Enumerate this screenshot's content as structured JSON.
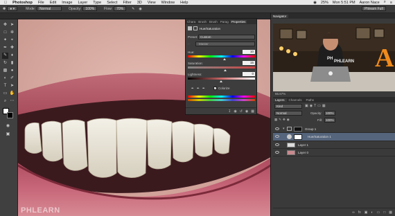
{
  "menubar": {
    "app": "Photoshop",
    "items": [
      "File",
      "Edit",
      "Image",
      "Layer",
      "Type",
      "Select",
      "Filter",
      "3D",
      "View",
      "Window",
      "Help"
    ],
    "battery": "25%",
    "clock": "Mon 5:51 PM",
    "user": "Aaron Nace"
  },
  "optbar": {
    "mode_label": "Mode:",
    "mode_value": "Normal",
    "opacity_label": "Opacity:",
    "opacity_value": "100%",
    "flow_label": "Flow:",
    "flow_value": "70%",
    "workspace": "Phlearn Full"
  },
  "properties": {
    "tabs": [
      "Chara",
      "Brush",
      "Brush",
      "Parag",
      "Properties"
    ],
    "title": "Hue/Saturation",
    "preset_label": "Preset:",
    "preset_value": "Custom",
    "channel_value": "Master",
    "hue_label": "Hue:",
    "hue_value": "10",
    "saturation_label": "Saturation:",
    "saturation_value": "15",
    "lightness_label": "Lightness:",
    "lightness_value": "0",
    "colorize_label": "Colorize",
    "colorize_checked": true
  },
  "navigator": {
    "tab": "Navigator",
    "zoom": "66.67%"
  },
  "layers_panel": {
    "tabs": [
      "Layers",
      "Channels",
      "Paths"
    ],
    "kind_value": "Kind",
    "blend_value": "Normal",
    "opacity_label": "Opacity:",
    "opacity_value": "100%",
    "fill_label": "Fill:",
    "fill_value": "100%",
    "layers": [
      {
        "name": "Group 1",
        "selected": false
      },
      {
        "name": "Hue/Saturation 1",
        "selected": true
      },
      {
        "name": "Layer 1",
        "selected": false
      },
      {
        "name": "Layer 0",
        "selected": false
      }
    ]
  },
  "watermark": "PHLEARN",
  "overlay_logo": "PHLEARN"
}
